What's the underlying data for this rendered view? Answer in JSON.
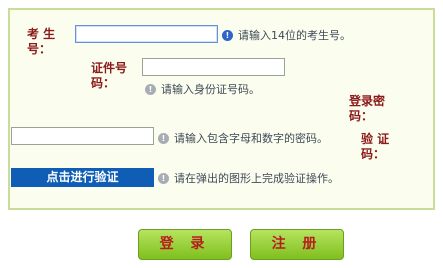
{
  "form": {
    "exam_number": {
      "label": "考 生\n号：",
      "value": "",
      "hint": "请输入14位的考生号。"
    },
    "id_number": {
      "label": "证件号\n码：",
      "value": "",
      "hint": "请输入身份证号码。"
    },
    "password": {
      "label": "登录密\n码：",
      "value": "",
      "hint": "请输入包含字母和数字的密码。"
    },
    "captcha": {
      "label": "验 证\n码：",
      "button": "点击进行验证",
      "hint": "请在弹出的图形上完成验证操作。"
    }
  },
  "actions": {
    "login": "登 录",
    "register": "注 册"
  },
  "colors": {
    "label": "#8b1a1a",
    "panel_bg": "#fbfdee",
    "panel_border": "#c9dc9a",
    "verify_button": "#0f5db4",
    "action_button": "#8cc63f"
  }
}
